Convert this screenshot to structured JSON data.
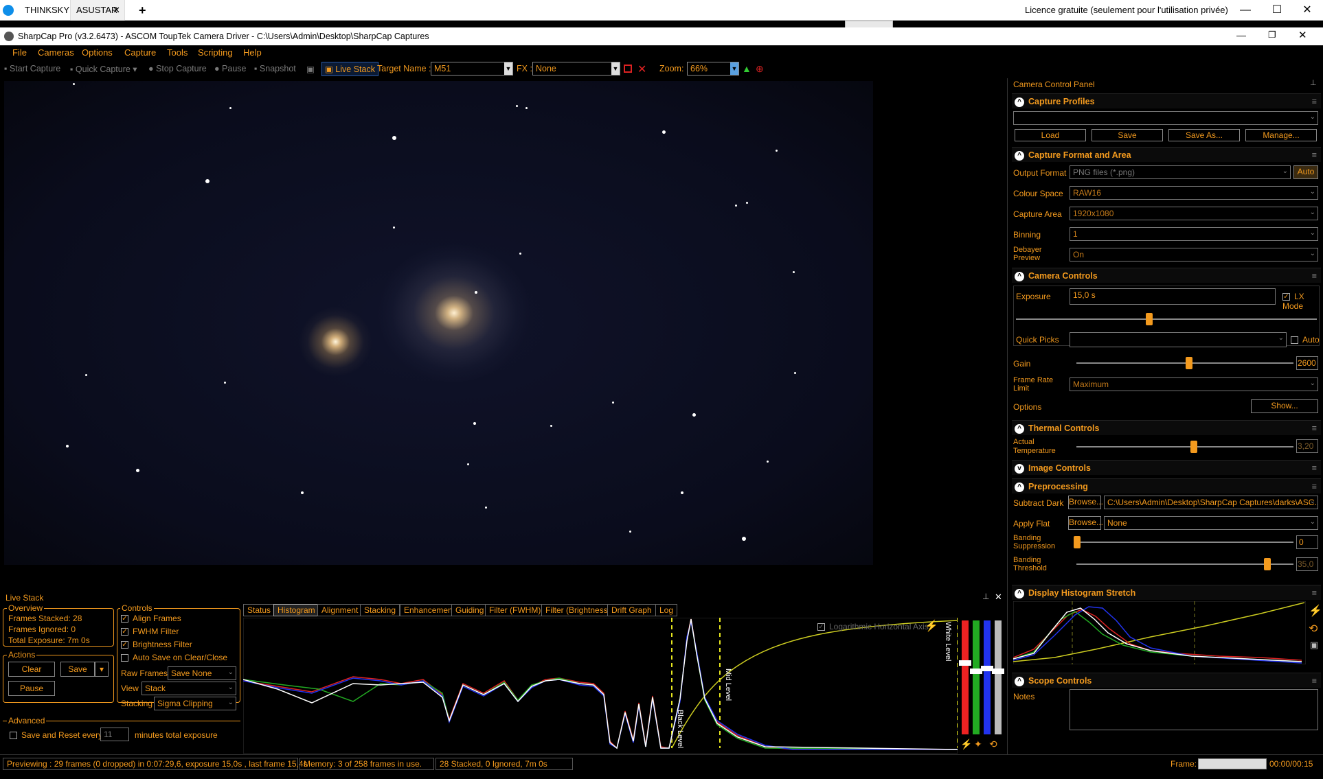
{
  "remote_tabs": [
    "THINKSKY",
    "ASUSTAR"
  ],
  "remote_license": "Licence gratuite (seulement pour l'utilisation privée)",
  "window_title": "SharpCap Pro (v3.2.6473) - ASCOM ToupTek Camera Driver - C:\\Users\\Admin\\Desktop\\SharpCap Captures",
  "menu": [
    "File",
    "Cameras",
    "Options",
    "Capture",
    "Tools",
    "Scripting",
    "Help"
  ],
  "toolbar": {
    "start_capture": "Start Capture",
    "quick_capture": "Quick Capture",
    "stop_capture": "Stop Capture",
    "pause": "Pause",
    "snapshot": "Snapshot",
    "live_stack": "Live Stack",
    "target_label": "Target Name :",
    "target_value": "M51",
    "fx_label": "FX :",
    "fx_value": "None",
    "zoom_label": "Zoom:",
    "zoom_value": "66%"
  },
  "panel": {
    "title": "Camera Control Panel",
    "capture_profiles": {
      "header": "Capture Profiles",
      "load": "Load",
      "save": "Save",
      "save_as": "Save As...",
      "manage": "Manage..."
    },
    "capture_format": {
      "header": "Capture Format and Area",
      "output_format_label": "Output Format",
      "output_format": "PNG files (*.png)",
      "auto": "Auto",
      "colour_space_label": "Colour Space",
      "colour_space": "RAW16",
      "capture_area_label": "Capture Area",
      "capture_area": "1920x1080",
      "binning_label": "Binning",
      "binning": "1",
      "debayer_label_1": "Debayer",
      "debayer_label_2": "Preview",
      "debayer": "On"
    },
    "camera_controls": {
      "header": "Camera Controls",
      "exposure_label": "Exposure",
      "exposure": "15,0 s",
      "lx_mode": "LX Mode",
      "quick_picks_label": "Quick Picks",
      "quick_auto": "Auto",
      "gain_label": "Gain",
      "gain": "2600",
      "frame_rate_label_1": "Frame Rate",
      "frame_rate_label_2": "Limit",
      "frame_rate": "Maximum",
      "options_label": "Options",
      "show": "Show..."
    },
    "thermal": {
      "header": "Thermal Controls",
      "temp_label_1": "Actual",
      "temp_label_2": "Temperature",
      "temp": "3,20"
    },
    "image_controls": {
      "header": "Image Controls"
    },
    "preprocessing": {
      "header": "Preprocessing",
      "dark_label": "Subtract Dark",
      "browse": "Browse...",
      "dark_path": "C:\\Users\\Admin\\Desktop\\SharpCap Captures\\darks\\ASC...",
      "flat_label": "Apply Flat",
      "flat": "None",
      "banding_supp_1": "Banding",
      "banding_supp_2": "Suppression",
      "banding_supp": "0",
      "banding_thr_1": "Banding",
      "banding_thr_2": "Threshold",
      "banding_thr": "35,0"
    },
    "histogram": {
      "header": "Display Histogram Stretch"
    },
    "scope": {
      "header": "Scope Controls",
      "notes": "Notes"
    }
  },
  "live_stack": {
    "title": "Live Stack",
    "overview_label": "Overview",
    "frames_stacked": "Frames Stacked: 28",
    "frames_ignored": "Frames Ignored:  0",
    "total_exposure": "Total Exposure:   7m 0s",
    "actions_label": "Actions",
    "clear": "Clear",
    "save": "Save",
    "pause": "Pause",
    "controls_label": "Controls",
    "align": "Align Frames",
    "fwhm": "FWHM Filter",
    "brightness": "Brightness Filter",
    "autosave": "Auto Save on Clear/Close",
    "raw_frames_label": "Raw Frames",
    "raw_frames": "Save None",
    "view_label": "View",
    "view": "Stack",
    "stacking_label": "Stacking",
    "stacking": "Sigma Clipping",
    "advanced_label": "Advanced",
    "save_reset": "Save and Reset every",
    "minutes_value": "11",
    "minutes_label": "minutes total exposure",
    "tabs": [
      "Status",
      "Histogram",
      "Alignment",
      "Stacking",
      "Enhancement",
      "Guiding",
      "Filter (FWHM)",
      "Filter (Brightness)",
      "Drift Graph",
      "Log"
    ],
    "log_axis": "Logarithmic Horizontal Axis",
    "black_level": "Black Level",
    "mid_level": "Mid Level",
    "white_level": "White Level"
  },
  "status": {
    "preview": "Previewing : 29 frames (0 dropped) in 0:07:29,6, exposure 15,0s , last frame 15,4s",
    "memory": "Memory: 3 of 258 frames in use.",
    "stacked": "28 Stacked, 0 Ignored, 7m 0s",
    "frame_label": "Frame:",
    "time": "00:00/00:15"
  },
  "colors": {
    "accent": "#f39a1e"
  }
}
